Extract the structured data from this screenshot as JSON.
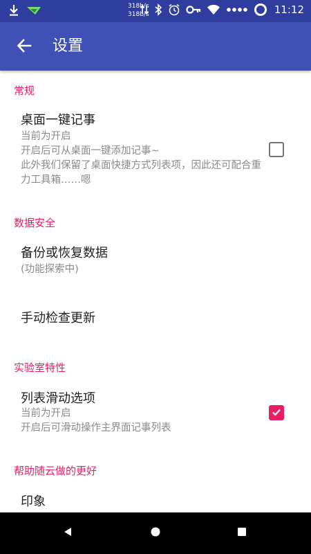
{
  "status_bar": {
    "net_speed_up": "318b/s",
    "net_speed_down": "318b/s",
    "time": "11:12",
    "icons": [
      "download-icon",
      "app-notification-icon",
      "data-arrows-icon",
      "bluetooth-icon",
      "alarm-icon",
      "vpn-key-icon",
      "wifi-icon",
      "more-dots-icon",
      "battery-ring-icon"
    ]
  },
  "app_bar": {
    "title": "设置",
    "back_icon": "arrow-back-icon",
    "color": "#3f51b5"
  },
  "sections": {
    "general": {
      "header": "常规",
      "quick_note": {
        "title": "桌面一键记事",
        "summary": "当前为开启\n开启后可从桌面一键添加记事~\n此外我们保留了桌面快捷方式列表项，因此还可配合重力工具箱……嗯",
        "checked": false
      }
    },
    "data_security": {
      "header": "数据安全",
      "backup": {
        "title": "备份或恢复数据",
        "summary": "(功能探索中)"
      },
      "update": {
        "title": "手动检查更新"
      }
    },
    "lab": {
      "header": "实验室特性",
      "swipe": {
        "title": "列表滑动选项",
        "summary": "当前为开启\n开启后可滑动操作主界面记事列表",
        "checked": true
      }
    },
    "help": {
      "header": "帮助随云做的更好",
      "impression": {
        "title": "印象"
      }
    }
  },
  "colors": {
    "accent": "#e91e63",
    "primary": "#3f51b5",
    "primary_dark": "#2f3e9e"
  },
  "nav_bar": {
    "icons": [
      "back-triangle-icon",
      "home-circle-icon",
      "recents-square-icon"
    ]
  }
}
